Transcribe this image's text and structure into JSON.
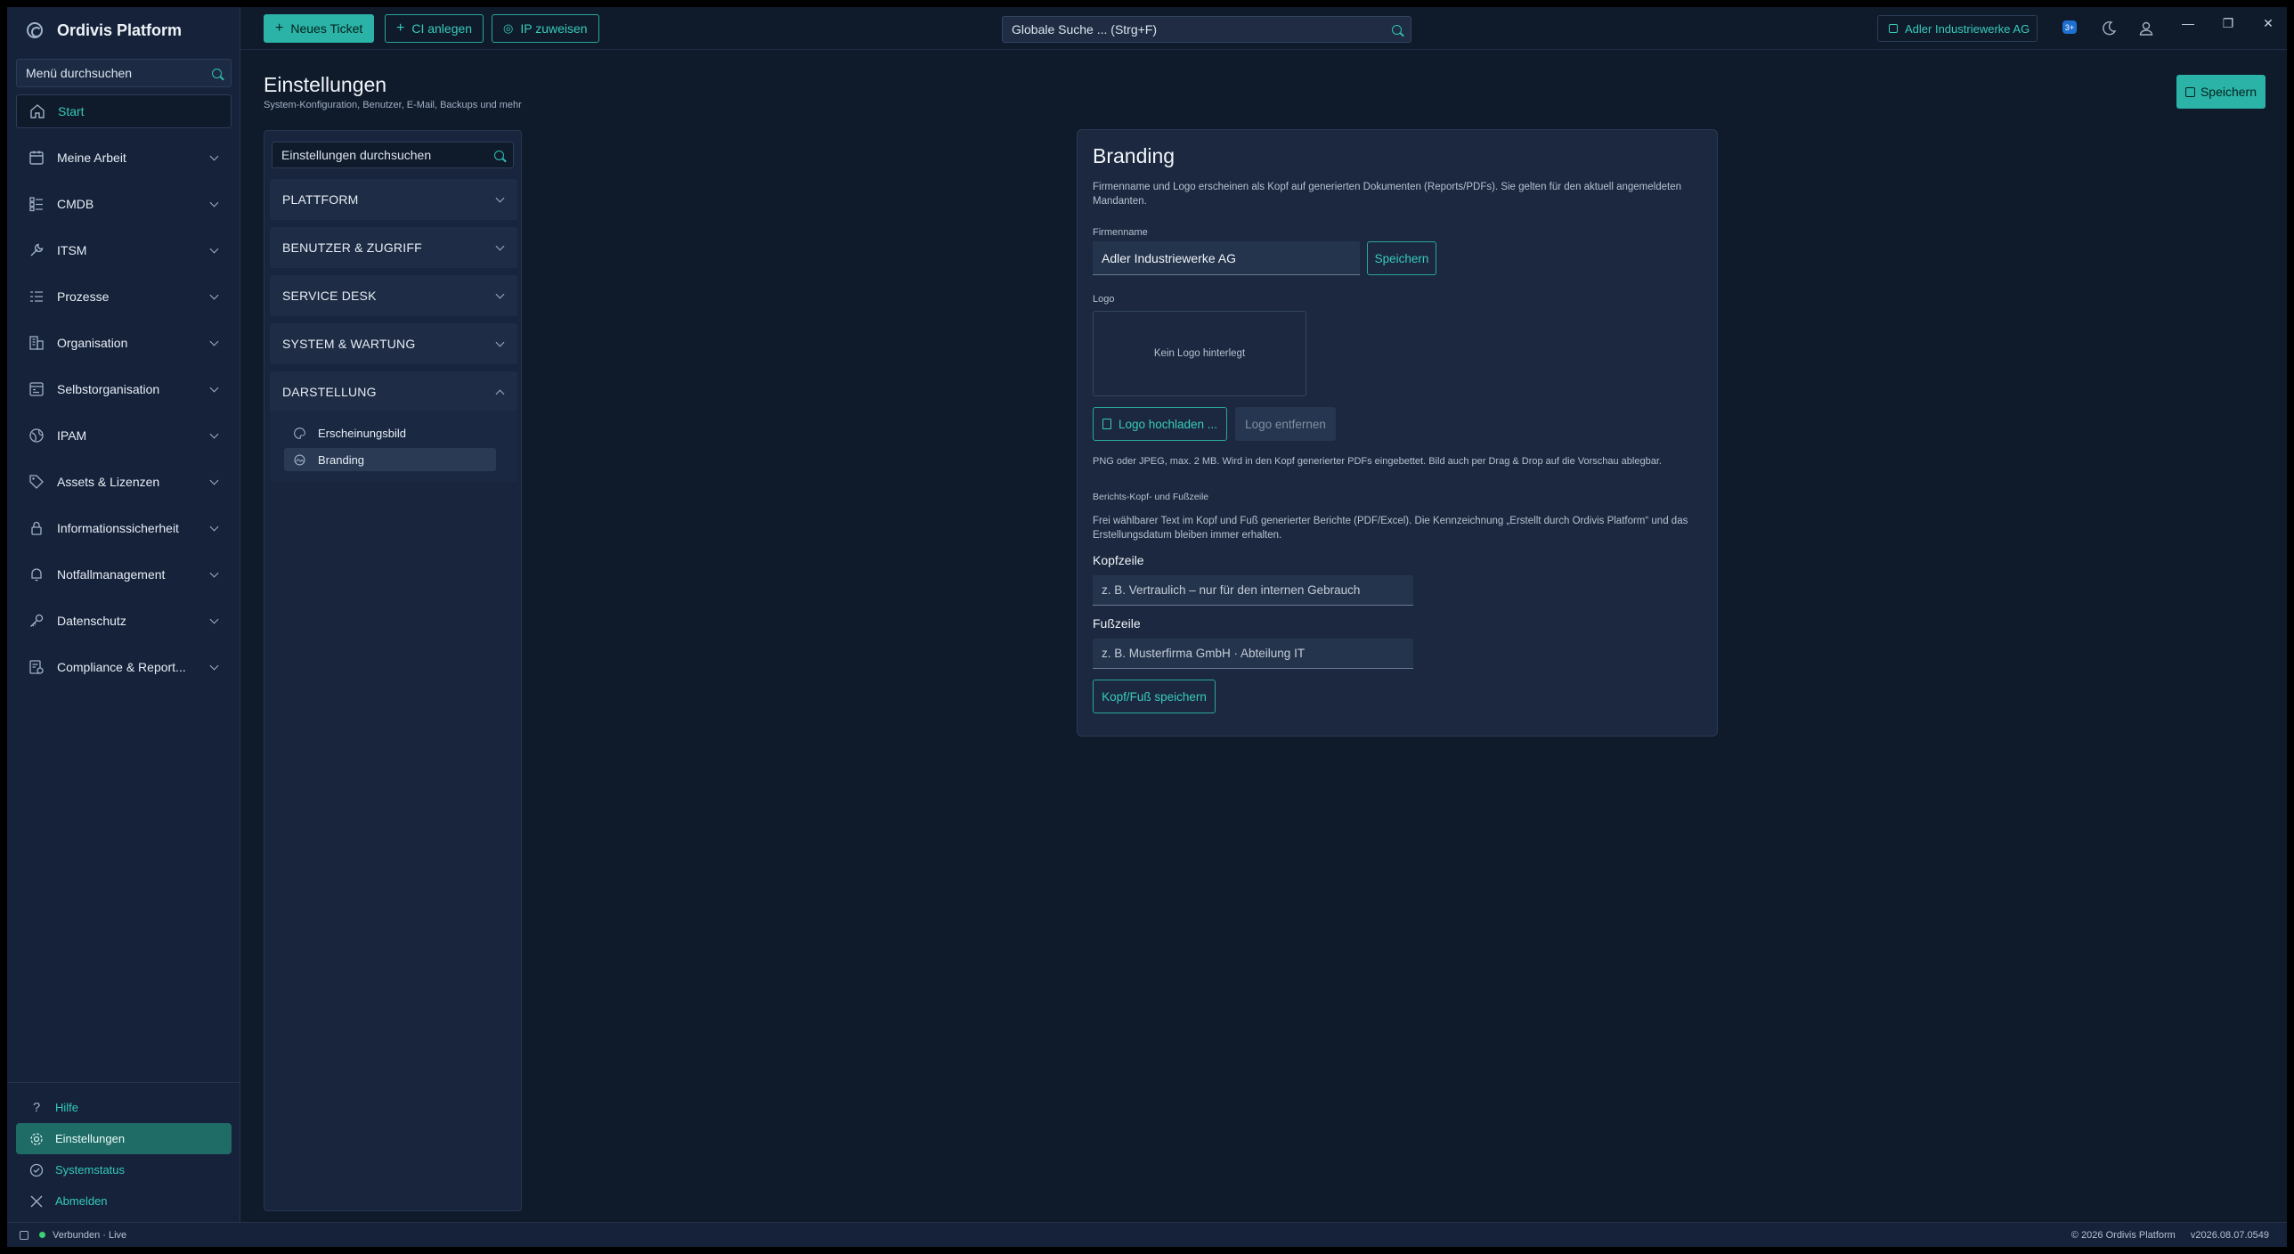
{
  "app": {
    "title": "Ordivis Platform"
  },
  "sidebar": {
    "search_placeholder": "Menü durchsuchen",
    "start": "Start",
    "items": [
      {
        "label": "Meine Arbeit",
        "icon": "calendar-icon"
      },
      {
        "label": "CMDB",
        "icon": "list-icon"
      },
      {
        "label": "ITSM",
        "icon": "wrench-icon"
      },
      {
        "label": "Prozesse",
        "icon": "process-icon"
      },
      {
        "label": "Organisation",
        "icon": "building-icon"
      },
      {
        "label": "Selbstorganisation",
        "icon": "planner-icon"
      },
      {
        "label": "IPAM",
        "icon": "globe-icon"
      },
      {
        "label": "Assets & Lizenzen",
        "icon": "tag-icon"
      },
      {
        "label": "Informationssicherheit",
        "icon": "lock-icon"
      },
      {
        "label": "Notfallmanagement",
        "icon": "bell-icon"
      },
      {
        "label": "Datenschutz",
        "icon": "key-icon"
      },
      {
        "label": "Compliance & Report...",
        "icon": "report-icon"
      }
    ],
    "bottom": {
      "help": "Hilfe",
      "settings": "Einstellungen",
      "status": "Systemstatus",
      "logout": "Abmelden"
    }
  },
  "topbar": {
    "new_ticket": "Neues Ticket",
    "new_ci": "CI anlegen",
    "assign_ip": "IP zuweisen",
    "search_placeholder": "Globale Suche ... (Strg+F)",
    "tenant": "Adler Industriewerke AG",
    "badge": "3+"
  },
  "page": {
    "title": "Einstellungen",
    "subtitle": "System-Konfiguration, Benutzer, E-Mail, Backups und mehr",
    "save": "Speichern"
  },
  "settings_nav": {
    "search_placeholder": "Einstellungen durchsuchen",
    "sections": [
      "PLATTFORM",
      "BENUTZER & ZUGRIFF",
      "SERVICE DESK",
      "SYSTEM & WARTUNG",
      "DARSTELLUNG"
    ],
    "sub_items": [
      "Erscheinungsbild",
      "Branding"
    ]
  },
  "branding": {
    "title": "Branding",
    "description": "Firmenname und Logo erscheinen als Kopf auf generierten Dokumenten (Reports/PDFs). Sie gelten für den aktuell angemeldeten Mandanten.",
    "company_label": "Firmenname",
    "company_value": "Adler Industriewerke AG",
    "save": "Speichern",
    "logo_label": "Logo",
    "no_logo": "Kein Logo hinterlegt",
    "upload": "Logo hochladen ...",
    "remove": "Logo entfernen",
    "logo_hint": "PNG oder JPEG, max. 2 MB. Wird in den Kopf generierter PDFs eingebettet. Bild auch per Drag & Drop auf die Vorschau ablegbar.",
    "report_heading": "Berichts-Kopf- und Fußzeile",
    "report_desc": "Frei wählbarer Text im Kopf und Fuß generierter Berichte (PDF/Excel). Die Kennzeichnung „Erstellt durch Ordivis Platform“ und das Erstellungsdatum bleiben immer erhalten.",
    "header_label": "Kopfzeile",
    "header_placeholder": "z. B. Vertraulich – nur für den internen Gebrauch",
    "footer_label": "Fußzeile",
    "footer_placeholder": "z. B. Musterfirma GmbH · Abteilung IT",
    "save_hf": "Kopf/Fuß speichern"
  },
  "statusbar": {
    "connection": "Verbunden · Live",
    "copyright": "© 2026 Ordivis Platform",
    "version": "v2026.08.07.0549"
  },
  "colors": {
    "accent": "#2ab3a6",
    "background": "#0f1a2b",
    "sidebar": "#15223a"
  }
}
